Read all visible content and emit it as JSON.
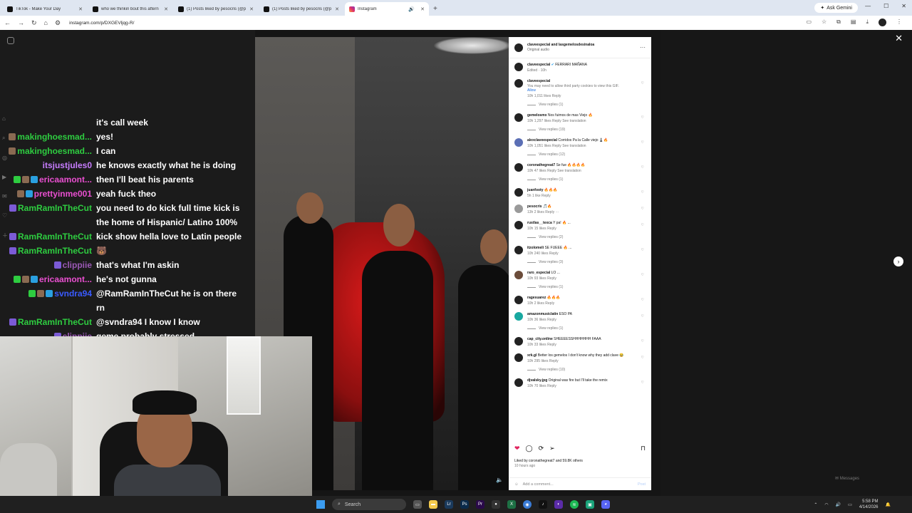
{
  "browser": {
    "tabs": [
      {
        "label": "TikTok - Make Your Day",
        "active": false,
        "icon": "tiktok-icon"
      },
      {
        "label": "who we thinkin bout this aftern",
        "active": false,
        "icon": "tiktok-icon"
      },
      {
        "label": "(1) Posts liked by pesocris (@p",
        "active": false,
        "icon": "x-icon"
      },
      {
        "label": "(1) Posts liked by pesocris (@p",
        "active": false,
        "icon": "x-icon"
      },
      {
        "label": "Instagram",
        "active": true,
        "icon": "instagram-icon"
      }
    ],
    "gemini_label": "Ask Gemini",
    "url": "instagram.com/p/DXGEVljqg-R/"
  },
  "post": {
    "author_line": "claveespecial and lasgemelosdesinaloa",
    "audio": "Original audio",
    "caption_user": "claveespecial",
    "caption_text": "FERRARI MAÑANA",
    "caption_meta": "Edited · 10h",
    "liked_by": "Liked by coronathegreat7 and 59.8K others",
    "time_ago": "10 hours ago",
    "add_comment_placeholder": "Add a comment...",
    "post_label": "Post"
  },
  "comments": [
    {
      "user": "claveespecial",
      "text": "",
      "note": "You may need to allow third party cookies to view this GIF.",
      "allow": "Allow",
      "meta": "10h  1,011 likes  Reply",
      "replies": "View replies (1)",
      "avatar": "dark"
    },
    {
      "user": "gemelosmx",
      "text": "Nos fuimos de mas Viejo 🔥",
      "meta": "10h  1,297 likes  Reply  See translation",
      "replies": "View replies (19)",
      "avatar": "dark"
    },
    {
      "user": "alexclaveespecial",
      "text": "Corridos Pa la Calle viejo ♟️🔥",
      "meta": "10h  1,051 likes  Reply  See translation",
      "replies": "View replies (12)",
      "avatar": "blue"
    },
    {
      "user": "coronathegreat7",
      "text": "Se fue 🔥🔥🔥🔥",
      "meta": "10h  47 likes  Reply  See translation",
      "replies": "View replies (1)",
      "avatar": "dark"
    },
    {
      "user": "juanfooty",
      "text": "🔥🔥🔥",
      "meta": "5h  1 like  Reply",
      "replies": "",
      "avatar": "dark"
    },
    {
      "user": "pesocris",
      "text": "🎵🔥",
      "meta": "13h  2 likes  Reply  ···",
      "replies": "",
      "avatar": "grey"
    },
    {
      "user": "rustlas__texca",
      "text": "Y pa! 🔥 ...",
      "meta": "10h  15 likes  Reply",
      "replies": "View replies (2)",
      "avatar": "dark"
    },
    {
      "user": "itzolomeli",
      "text": "SE FUEEE 🔥 ...",
      "meta": "10h  240 likes  Reply",
      "replies": "View replies (3)",
      "avatar": "dark"
    },
    {
      "user": "raro_especial",
      "text": "LO ...",
      "meta": "10h  93 likes  Reply",
      "replies": "View replies (1)",
      "avatar": "brown"
    },
    {
      "user": "ragesuarez",
      "text": "🔥🔥🔥",
      "meta": "10h  2 likes  Reply",
      "replies": "",
      "avatar": "dark"
    },
    {
      "user": "amazonmusiclatin",
      "text": "ESO PA",
      "meta": "10h  36 likes  Reply",
      "replies": "View replies (1)",
      "avatar": "teal"
    },
    {
      "user": "cap_city.online",
      "text": "SHEEEESSHHHHHHH FAAA",
      "meta": "10h  33 likes  Reply",
      "replies": "",
      "avatar": "dark"
    },
    {
      "user": "xrk.gl",
      "text": "Better los gemelos I don't know why they add clave 😂",
      "meta": "10h  295 likes  Reply",
      "replies": "View replies (10)",
      "avatar": "dark"
    },
    {
      "user": "djvalsky.jpg",
      "text": "Original was fire but I'll take the remix",
      "meta": "10h  70 likes  Reply",
      "replies": "",
      "avatar": "dark"
    }
  ],
  "chat": [
    {
      "name": "",
      "color": "#ffffff",
      "text": "it's call week",
      "badges": []
    },
    {
      "name": "makinghoesmad...",
      "color": "#2ecc40",
      "text": "yes!",
      "badges": [
        "avatar"
      ]
    },
    {
      "name": "makinghoesmad...",
      "color": "#2ecc40",
      "text": "I can",
      "badges": [
        "avatar"
      ]
    },
    {
      "name": "itsjustjules0",
      "color": "#c77dff",
      "text": "he knows exactly what he is doing",
      "badges": []
    },
    {
      "name": "ericaamont...",
      "color": "#e94fd0",
      "text": "then I'll beat his parents",
      "badges": [
        "check",
        "avatar",
        "crown"
      ]
    },
    {
      "name": "prettyinme001",
      "color": "#e94fd0",
      "text": "yeah fuck theo",
      "badges": [
        "avatar",
        "crown"
      ]
    },
    {
      "name": "RamRamInTheCut",
      "color": "#2ecc40",
      "text": "you need to do kick full time kick is the home of Hispanic/ Latino 100%",
      "badges": [
        "game"
      ]
    },
    {
      "name": "RamRamInTheCut",
      "color": "#2ecc40",
      "text": "kick show hella love to Latin people",
      "badges": [
        "game"
      ]
    },
    {
      "name": "RamRamInTheCut",
      "color": "#2ecc40",
      "text": "🐻",
      "badges": [
        "game"
      ]
    },
    {
      "name": "clippiie",
      "color": "#9b59b6",
      "text": "that's what I'm askin",
      "badges": [
        "play"
      ]
    },
    {
      "name": "ericaamont...",
      "color": "#e94fd0",
      "text": "he's not gunna",
      "badges": [
        "check",
        "avatar",
        "crown"
      ]
    },
    {
      "name": "svndra94",
      "color": "#3a5bff",
      "text": "@RamRamInTheCut he is on there rn",
      "badges": [
        "check",
        "avatar",
        "crown"
      ]
    },
    {
      "name": "RamRamInTheCut",
      "color": "#2ecc40",
      "text": "@svndra94 I know I know",
      "badges": [
        "game"
      ]
    },
    {
      "name": "clippiie",
      "color": "#9b59b6",
      "text": "geme probably stressed",
      "badges": [
        "play"
      ]
    }
  ],
  "taskbar": {
    "search_placeholder": "Search",
    "time": "5:58 PM",
    "date": "4/14/2026",
    "messages": "Messages"
  }
}
